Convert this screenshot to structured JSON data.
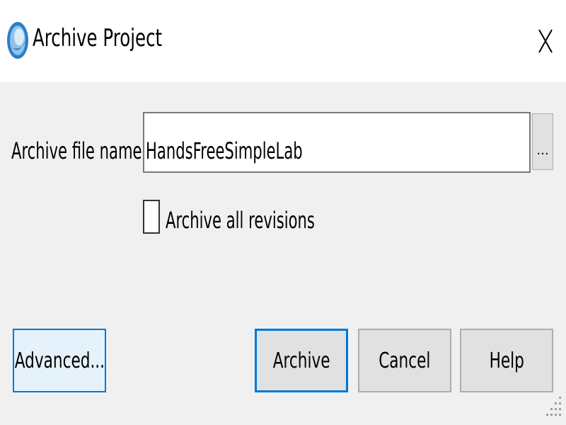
{
  "window": {
    "title": "Archive Project",
    "icon": "quartus-app-icon",
    "close_label": "X"
  },
  "form": {
    "filename_label": "Archive file name:",
    "filename_value": "HandsFreeSimpleLab",
    "browse_label": "...",
    "checkbox_label": "Archive all revisions",
    "checkbox_checked": false
  },
  "buttons": {
    "advanced": "Advanced...",
    "archive": "Archive",
    "cancel": "Cancel",
    "help": "Help"
  },
  "colors": {
    "accent": "#0078d7",
    "dialog_bg": "#f0f0f0",
    "titlebar_bg": "#ffffff"
  }
}
